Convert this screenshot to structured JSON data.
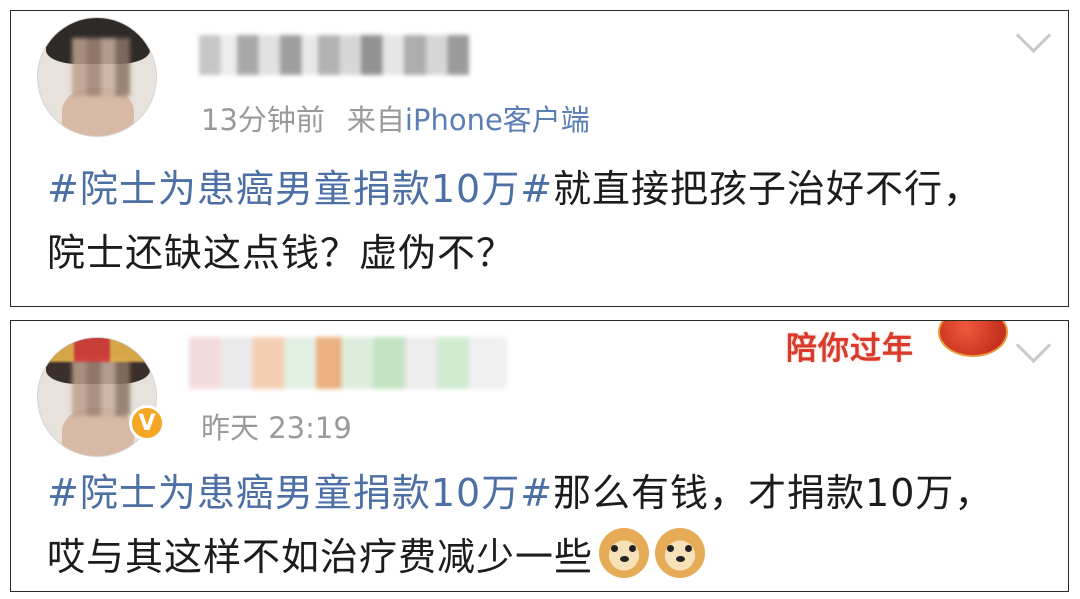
{
  "posts": [
    {
      "time": "13分钟前",
      "source_label": "来自",
      "source_device": "iPhone客户端",
      "hashtag": "#院士为患癌男童捐款10万#",
      "text": "就直接把孩子治好不行，院士还缺这点钱？虚伪不？",
      "icons": [
        "avatar",
        "chevron-down-icon"
      ]
    },
    {
      "time": "昨天 23:19",
      "hashtag": "#院士为患癌男童捐款10万#",
      "text": "那么有钱，才捐款10万，哎与其这样不如治疗费减少一些",
      "badge": "V",
      "banner": "陪你过年",
      "emojis": [
        "doge-icon",
        "doge-icon"
      ],
      "icons": [
        "avatar",
        "verified-badge-icon",
        "lantern-icon",
        "chevron-down-icon"
      ]
    }
  ]
}
